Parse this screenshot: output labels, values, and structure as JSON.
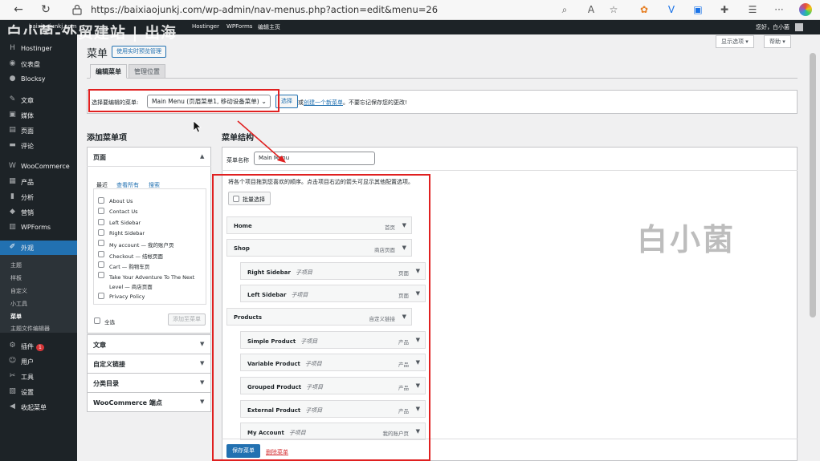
{
  "browser": {
    "url": "https://baixiaojunkj.com/wp-admin/nav-menus.php?action=edit&menu=26",
    "back": "←",
    "reload": "↻",
    "more": "···"
  },
  "admin_bar": {
    "site": "baixiaojunkj.com",
    "items": [
      "Hostinger",
      "WPForms",
      "编辑主页"
    ],
    "greeting": "您好，白小菌"
  },
  "watermarks": {
    "top": "白小菌-外贸建站 | 出海",
    "center": "白小菌"
  },
  "sidebar": {
    "items": [
      {
        "label": "Hostinger",
        "icon": "hostinger-icon",
        "glyph": "H"
      },
      {
        "label": "仪表盘",
        "icon": "dashboard-icon",
        "glyph": "◉"
      },
      {
        "label": "Blocksy",
        "icon": "blocksy-icon",
        "glyph": "●"
      },
      {
        "label": "文章",
        "icon": "pin-icon",
        "glyph": "✎"
      },
      {
        "label": "媒体",
        "icon": "media-icon",
        "glyph": "▣"
      },
      {
        "label": "页面",
        "icon": "page-icon",
        "glyph": "▤"
      },
      {
        "label": "评论",
        "icon": "comment-icon",
        "glyph": "▬"
      },
      {
        "label": "WooCommerce",
        "icon": "woocommerce-icon",
        "glyph": "W"
      },
      {
        "label": "产品",
        "icon": "product-icon",
        "glyph": "▦"
      },
      {
        "label": "分析",
        "icon": "analytics-icon",
        "glyph": "▮"
      },
      {
        "label": "营销",
        "icon": "marketing-icon",
        "glyph": "◆"
      },
      {
        "label": "WPForms",
        "icon": "wpforms-icon",
        "glyph": "▥"
      },
      {
        "label": "外观",
        "icon": "appearance-icon",
        "glyph": "✐"
      }
    ],
    "sub_items": [
      "主题",
      "样板",
      "自定义",
      "小工具",
      "菜单",
      "主题文件编辑器"
    ],
    "bottom_items": [
      {
        "label": "插件",
        "icon": "plugins-icon",
        "glyph": "⚙",
        "badge": "1"
      },
      {
        "label": "用户",
        "icon": "users-icon",
        "glyph": "☺"
      },
      {
        "label": "工具",
        "icon": "tools-icon",
        "glyph": "✂"
      },
      {
        "label": "设置",
        "icon": "settings-icon",
        "glyph": "▧"
      },
      {
        "label": "收起菜单",
        "icon": "collapse-icon",
        "glyph": "◀"
      }
    ]
  },
  "header": {
    "title": "菜单",
    "live_preview_button": "使用实时预览管理",
    "screen_options": "显示选项 ▾",
    "help": "帮助 ▾"
  },
  "tabs": [
    "编辑菜单",
    "管理位置"
  ],
  "menu_select": {
    "label": "选择要编辑的菜单:",
    "selected": "Main Menu (页眉菜单1, 移动设备菜单)",
    "select_button": "选择",
    "or_text": "或",
    "create_link": "创建一个新菜单",
    "reminder": "。不要忘记保存您的更改!"
  },
  "add_items": {
    "heading": "添加菜单项",
    "pages_title": "页面",
    "inner_tabs": [
      "最近",
      "查看所有",
      "搜索"
    ],
    "pages": [
      "About Us",
      "Contact Us",
      "Left Sidebar",
      "Right Sidebar",
      "My account — 我的账户页",
      "Checkout — 结帐页面",
      "Cart — 购物车页",
      "Take Your Adventure To The Next Level — 商店页面",
      "Privacy Policy"
    ],
    "select_all": "全选",
    "add_button": "添加至菜单",
    "other_sections": [
      "文章",
      "自定义链接",
      "分类目录",
      "WooCommerce 端点"
    ]
  },
  "structure": {
    "heading": "菜单结构",
    "name_label": "菜单名称",
    "name_value": "Main Menu",
    "hint": "将各个项目拖到您喜欢的顺序。点击项目右边的箭头可显示其他配置选项。",
    "bulk_select": "批量选择",
    "items": [
      {
        "title": "Home",
        "sub": "",
        "type": "首页",
        "level": 0
      },
      {
        "title": "Shop",
        "sub": "",
        "type": "商店页面",
        "level": 0
      },
      {
        "title": "Right Sidebar",
        "sub": "子项目",
        "type": "页面",
        "level": 1
      },
      {
        "title": "Left Sidebar",
        "sub": "子项目",
        "type": "页面",
        "level": 1
      },
      {
        "title": "Products",
        "sub": "",
        "type": "自定义链接",
        "level": 0
      },
      {
        "title": "Simple Product",
        "sub": "子项目",
        "type": "产品",
        "level": 1
      },
      {
        "title": "Variable Product",
        "sub": "子项目",
        "type": "产品",
        "level": 1
      },
      {
        "title": "Grouped Product",
        "sub": "子项目",
        "type": "产品",
        "level": 1
      },
      {
        "title": "External Product",
        "sub": "子项目",
        "type": "产品",
        "level": 1
      },
      {
        "title": "My Account",
        "sub": "子项目",
        "type": "我的账户页",
        "level": 1
      }
    ],
    "save_button": "保存菜单",
    "delete_link": "删除菜单"
  }
}
